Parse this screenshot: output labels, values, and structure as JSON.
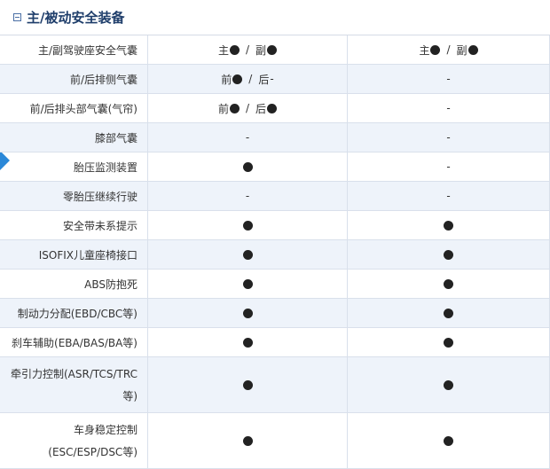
{
  "section": {
    "title": "主/被动安全装备",
    "toggle": "collapse"
  },
  "colors": {
    "accent": "#2b88d8",
    "alt_row": "#eef3fa",
    "title": "#1f3e6b",
    "dot": "#222222"
  },
  "rows": [
    {
      "label": "主/副驾驶座安全气囊",
      "col1": {
        "type": "pair",
        "a": "主",
        "sa": "filled",
        "b": "副",
        "sb": "filled"
      },
      "col2": {
        "type": "pair",
        "a": "主",
        "sa": "filled",
        "b": "副",
        "sb": "filled"
      }
    },
    {
      "label": "前/后排侧气囊",
      "col1": {
        "type": "pair",
        "a": "前",
        "sa": "filled",
        "b": "后",
        "sb": "-"
      },
      "col2": {
        "type": "dash",
        "text": "-"
      }
    },
    {
      "label": "前/后排头部气囊(气帘)",
      "col1": {
        "type": "pair",
        "a": "前",
        "sa": "filled",
        "b": "后",
        "sb": "filled"
      },
      "col2": {
        "type": "dash",
        "text": "-"
      }
    },
    {
      "label": "膝部气囊",
      "col1": {
        "type": "dash",
        "text": "-"
      },
      "col2": {
        "type": "dash",
        "text": "-"
      }
    },
    {
      "label": "胎压监测装置",
      "col1": {
        "type": "dot"
      },
      "col2": {
        "type": "dash",
        "text": "-"
      }
    },
    {
      "label": "零胎压继续行驶",
      "col1": {
        "type": "dash",
        "text": "-"
      },
      "col2": {
        "type": "dash",
        "text": "-"
      }
    },
    {
      "label": "安全带未系提示",
      "col1": {
        "type": "dot"
      },
      "col2": {
        "type": "dot"
      }
    },
    {
      "label": "ISOFIX儿童座椅接口",
      "col1": {
        "type": "dot"
      },
      "col2": {
        "type": "dot"
      }
    },
    {
      "label": "ABS防抱死",
      "col1": {
        "type": "dot"
      },
      "col2": {
        "type": "dot"
      }
    },
    {
      "label": "制动力分配(EBD/CBC等)",
      "col1": {
        "type": "dot"
      },
      "col2": {
        "type": "dot"
      }
    },
    {
      "label": "刹车辅助(EBA/BAS/BA等)",
      "col1": {
        "type": "dot"
      },
      "col2": {
        "type": "dot"
      }
    },
    {
      "label_lines": [
        "牵引力控制(ASR/TCS/TRC",
        "等)"
      ],
      "col1": {
        "type": "dot"
      },
      "col2": {
        "type": "dot"
      }
    },
    {
      "label_lines": [
        "车身稳定控制",
        "(ESC/ESP/DSC等)"
      ],
      "col1": {
        "type": "dot"
      },
      "col2": {
        "type": "dot"
      }
    }
  ]
}
